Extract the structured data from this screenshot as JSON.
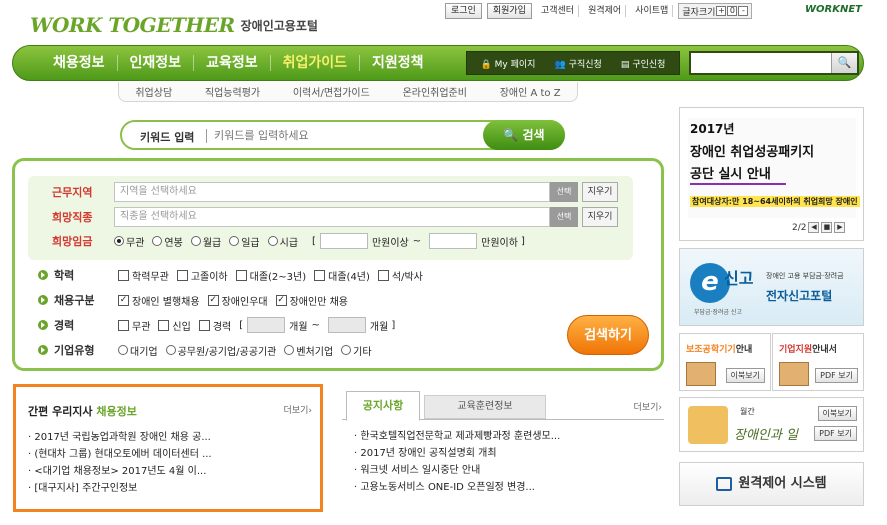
{
  "header": {
    "logo": "WORK TOGETHER",
    "logo_sub": "장애인고용포털",
    "utility": {
      "login": "로그인",
      "join": "회원가입",
      "support": "고객센터",
      "remote": "원격제어",
      "sitemap": "사이트맵",
      "font_size": "글자크기",
      "font_plus": "+",
      "font_reset": "0",
      "font_minus": "-"
    },
    "worknet": "WORKNET"
  },
  "nav": {
    "items": [
      "채용정보",
      "인재정보",
      "교육정보",
      "취업가이드",
      "지원정책"
    ],
    "active_index": 3,
    "my_page": "My 페이지",
    "job_apply": "구직신청",
    "recruit_apply": "구인신청",
    "search_icon": "magnifier-icon"
  },
  "subnav": [
    "취업상담",
    "직업능력평가",
    "이력서/면접가이드",
    "온라인취업준비",
    "장애인 A to Z"
  ],
  "keyword": {
    "label": "키워드 입력",
    "placeholder": "키워드를 입력하세요",
    "button": "검색"
  },
  "filters": {
    "work_area": {
      "label": "근무지역",
      "placeholder": "지역을 선택하세요",
      "select": "선택",
      "clear": "지우기"
    },
    "job_type": {
      "label": "희망직종",
      "placeholder": "직종을 선택하세요",
      "select": "선택",
      "clear": "지우기"
    },
    "wage": {
      "label": "희망임금",
      "options": [
        "무관",
        "연봉",
        "월급",
        "일급",
        "시급"
      ],
      "selected": 0,
      "min_open": "[",
      "min_label": "만원이상",
      "tilde": "~",
      "max_label": "만원이하",
      "max_close": "]"
    },
    "education": {
      "label": "학력",
      "options": [
        "학력무관",
        "고졸이하",
        "대졸(2~3년)",
        "대졸(4년)",
        "석/박사"
      ],
      "checked": []
    },
    "employ": {
      "label": "채용구분",
      "options": [
        "장애인 별행채용",
        "장애인우대",
        "장애인만 채용"
      ],
      "checked": [
        0,
        1,
        2
      ]
    },
    "career": {
      "label": "경력",
      "options": [
        "무관",
        "신입",
        "경력"
      ],
      "open": "[",
      "unit1": "개월",
      "tilde": "~",
      "unit2": "개월",
      "close": "]"
    },
    "company": {
      "label": "기업유형",
      "options": [
        "대기업",
        "공무원/공기업/공공기관",
        "벤처기업",
        "기타"
      ]
    },
    "search_button": "검색하기"
  },
  "branch": {
    "title_prefix": "간편 우리지사",
    "title_highlight": "채용정보",
    "more": "더보기",
    "items": [
      "2017년 국립농업과학원 장애인 채용 공...",
      "(현대차 그룹) 현대오토에버 데이터센터 ...",
      "<대기업 채용정보> 2017년도 4월 이...",
      "[대구지사] 주간구인정보"
    ]
  },
  "notice": {
    "tab_active": "공지사항",
    "tab_other": "교육훈련정보",
    "more": "더보기",
    "items": [
      "한국호텔직업전문학교 제과제빵과정 훈련생모...",
      "2017년 장애인 공직설명회 개최",
      "워크넷 서비스 일시중단 안내",
      "고용노동서비스 ONE-ID 오픈일정 변경..."
    ]
  },
  "banners": {
    "package": {
      "line1": "2017년",
      "line2": "장애인 취업성공패키지",
      "line3": "공단 실시 안내",
      "line4": "참여대상자:만 18~64세이하의 취업희망 장애인",
      "page": "2/2"
    },
    "esingo": {
      "e": "e",
      "singo": "신고",
      "small": "장애인 고용 부담금·장려금",
      "big": "전자신고포털",
      "tiny": "부담금·장려금 신고"
    },
    "deduction": {
      "title_highlight": "보조공학기기",
      "title_rest": "안내",
      "btn": "이북보기"
    },
    "support": {
      "title_highlight": "기업지원",
      "title_rest": "안내서",
      "btn": "PDF 보기"
    },
    "monthly": {
      "small": "월간",
      "title": "장애인과 일",
      "btn1": "이북보기",
      "btn2": "PDF 보기"
    },
    "remote": {
      "label": "원격제어 시스템"
    }
  }
}
